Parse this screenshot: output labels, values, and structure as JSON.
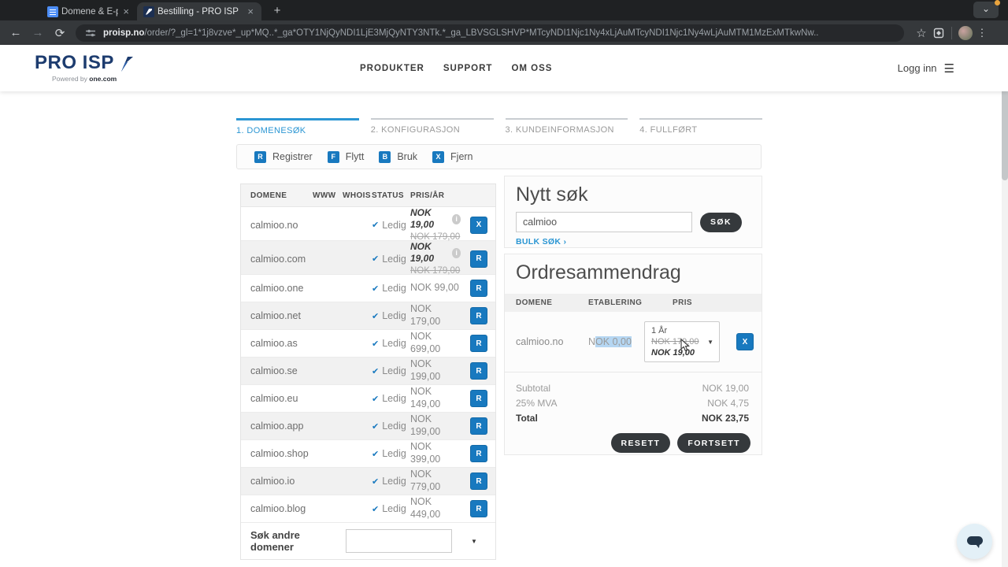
{
  "browser": {
    "tabs": [
      {
        "title": "Domene & E-post konto - Go",
        "active": false
      },
      {
        "title": "Bestilling - PRO ISP",
        "active": true
      }
    ],
    "url_domain": "proisp.no",
    "url_path": "/order/?_gl=1*1j8vzve*_up*MQ..*_ga*OTY1NjQyNDI1LjE3MjQyNTY3NTk.*_ga_LBVSGLSHVP*MTcyNDI1Njc1Ny4xLjAuMTcyNDI1Njc1Ny4wLjAuMTM1MzExMTkwNw.."
  },
  "header": {
    "logo_text": "PRO ISP",
    "logo_sub_prefix": "Powered by",
    "logo_sub_brand": "one.com",
    "nav": [
      "PRODUKTER",
      "SUPPORT",
      "OM OSS"
    ],
    "login_label": "Logg inn"
  },
  "steps": [
    {
      "label": "1. DOMENESØK",
      "active": true
    },
    {
      "label": "2. KONFIGURASJON",
      "active": false
    },
    {
      "label": "3. KUNDEINFORMASJON",
      "active": false
    },
    {
      "label": "4. FULLFØRT",
      "active": false
    }
  ],
  "legend": [
    {
      "badge": "R",
      "label": "Registrer"
    },
    {
      "badge": "F",
      "label": "Flytt"
    },
    {
      "badge": "B",
      "label": "Bruk"
    },
    {
      "badge": "X",
      "label": "Fjern"
    }
  ],
  "domain_table": {
    "headers": [
      "DOMENE",
      "WWW",
      "WHOIS",
      "STATUS",
      "PRIS/ÅR"
    ],
    "rows": [
      {
        "domain": "calmioo.no",
        "status": "Ledig",
        "price": "NOK 19,00",
        "old_price": "NOK 179,00",
        "promo": true,
        "action": "X"
      },
      {
        "domain": "calmioo.com",
        "status": "Ledig",
        "price": "NOK 19,00",
        "old_price": "NOK 179,00",
        "promo": true,
        "action": "R"
      },
      {
        "domain": "calmioo.one",
        "status": "Ledig",
        "price": "NOK 99,00",
        "promo": false,
        "action": "R"
      },
      {
        "domain": "calmioo.net",
        "status": "Ledig",
        "price": "NOK 179,00",
        "promo": false,
        "action": "R"
      },
      {
        "domain": "calmioo.as",
        "status": "Ledig",
        "price": "NOK 699,00",
        "promo": false,
        "action": "R"
      },
      {
        "domain": "calmioo.se",
        "status": "Ledig",
        "price": "NOK 199,00",
        "promo": false,
        "action": "R"
      },
      {
        "domain": "calmioo.eu",
        "status": "Ledig",
        "price": "NOK 149,00",
        "promo": false,
        "action": "R"
      },
      {
        "domain": "calmioo.app",
        "status": "Ledig",
        "price": "NOK 199,00",
        "promo": false,
        "action": "R"
      },
      {
        "domain": "calmioo.shop",
        "status": "Ledig",
        "price": "NOK 399,00",
        "promo": false,
        "action": "R"
      },
      {
        "domain": "calmioo.io",
        "status": "Ledig",
        "price": "NOK 779,00",
        "promo": false,
        "action": "R"
      },
      {
        "domain": "calmioo.blog",
        "status": "Ledig",
        "price": "NOK 449,00",
        "promo": false,
        "action": "R"
      }
    ],
    "footer_label": "Søk andre domener"
  },
  "new_search": {
    "title": "Nytt søk",
    "input_value": "calmioo",
    "search_button": "SØK",
    "bulk_link": "BULK SØK ›"
  },
  "order_summary": {
    "title": "Ordresammendrag",
    "headers": [
      "DOMENE",
      "ETABLERING",
      "PRIS"
    ],
    "item": {
      "domain": "calmioo.no",
      "setup_prefix": "N",
      "setup_selected": "OK 0,00",
      "period": "1 År",
      "old_price": "NOK 179,00",
      "price": "NOK 19,00",
      "remove": "X"
    },
    "totals": [
      {
        "label": "Subtotal",
        "value": "NOK 19,00"
      },
      {
        "label": "25% MVA",
        "value": "NOK 4,75"
      },
      {
        "label": "Total",
        "value": "NOK 23,75"
      }
    ],
    "reset_button": "RESETT",
    "continue_button": "FORTSETT"
  },
  "icons": {
    "back": "←",
    "forward": "→",
    "reload": "⟳",
    "star": "☆",
    "kebab": "⋮",
    "close": "×",
    "new_tab": "+",
    "chevron_down": "⌄",
    "hamburger": "☰",
    "check": "✔",
    "info": "i",
    "caret_down": "▼"
  },
  "colors": {
    "accent_blue": "#1879bf",
    "link_blue": "#2b96d3",
    "dark_button": "#35393c",
    "brand_navy": "#1d3c6f",
    "selection_blue": "#b5d6f2"
  }
}
